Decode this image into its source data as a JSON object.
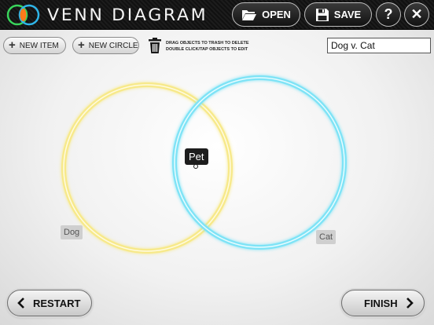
{
  "header": {
    "app_title": "Venn Diagram",
    "open_label": "OPEN",
    "save_label": "SAVE",
    "help_label": "?",
    "close_label": "✕"
  },
  "toolbar": {
    "new_item_label": "NEW ITEM",
    "new_circle_label": "NEW CIRCLE",
    "hint_line1": "DRAG OBJECTS TO TRASH TO DELETE",
    "hint_line2": "DOUBLE CLICK/TAP OBJECTS TO EDIT",
    "diagram_title": "Dog v. Cat"
  },
  "diagram": {
    "circles": [
      {
        "label": "Dog",
        "color": "#f7e98a"
      },
      {
        "label": "Cat",
        "color": "#7ee3f6"
      }
    ],
    "items": [
      {
        "label": "Pet"
      }
    ]
  },
  "footer": {
    "restart_label": "RESTART",
    "finish_label": "FINISH"
  },
  "icons": {
    "logo": "venn-logo-icon",
    "open": "folder-open-icon",
    "save": "floppy-disk-icon",
    "trash": "trash-icon",
    "back": "chevron-left-icon",
    "forward": "chevron-right-icon"
  }
}
